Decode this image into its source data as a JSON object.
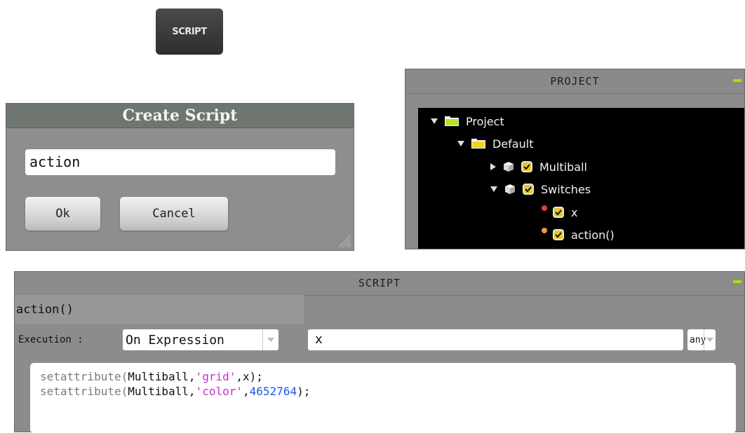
{
  "top_button": {
    "label": "SCRIPT"
  },
  "create_dialog": {
    "title": "Create Script",
    "input_value": "action",
    "ok_label": "Ok",
    "cancel_label": "Cancel"
  },
  "project_panel": {
    "title": "PROJECT",
    "tree": [
      {
        "label": "Project",
        "icon": "folder-icon",
        "expanded": true
      },
      {
        "label": "Default",
        "icon": "folder-icon",
        "expanded": true
      },
      {
        "label": "Multiball",
        "icon": "cube-icon",
        "expanded": false,
        "checked": true
      },
      {
        "label": "Switches",
        "icon": "cube-icon",
        "expanded": true,
        "checked": true
      },
      {
        "label": "x",
        "icon": "red-dot-icon",
        "checked": true,
        "dot_color": "#e0433a"
      },
      {
        "label": "action()",
        "icon": "orange-dot-icon",
        "checked": true,
        "dot_color": "#e8955a"
      }
    ]
  },
  "script_panel": {
    "title": "SCRIPT",
    "script_name": "action()",
    "execution_label": "Execution :",
    "execution_mode": "On Expression",
    "expression": "x",
    "trigger": "any",
    "code_lines": [
      {
        "fn": "setattribute(",
        "obj": "Multiball,",
        "str": "'grid'",
        "rest": ",x);",
        "num": ""
      },
      {
        "fn": "setattribute(",
        "obj": "Multiball,",
        "str": "'color'",
        "rest": ",",
        "num": "4652764",
        "end": ");"
      }
    ]
  },
  "colors": {
    "accent_minimize": "#a8e000",
    "string_literal": "#cc2fcc",
    "number_literal": "#1f55e0",
    "checkbox": "#e6c820"
  }
}
